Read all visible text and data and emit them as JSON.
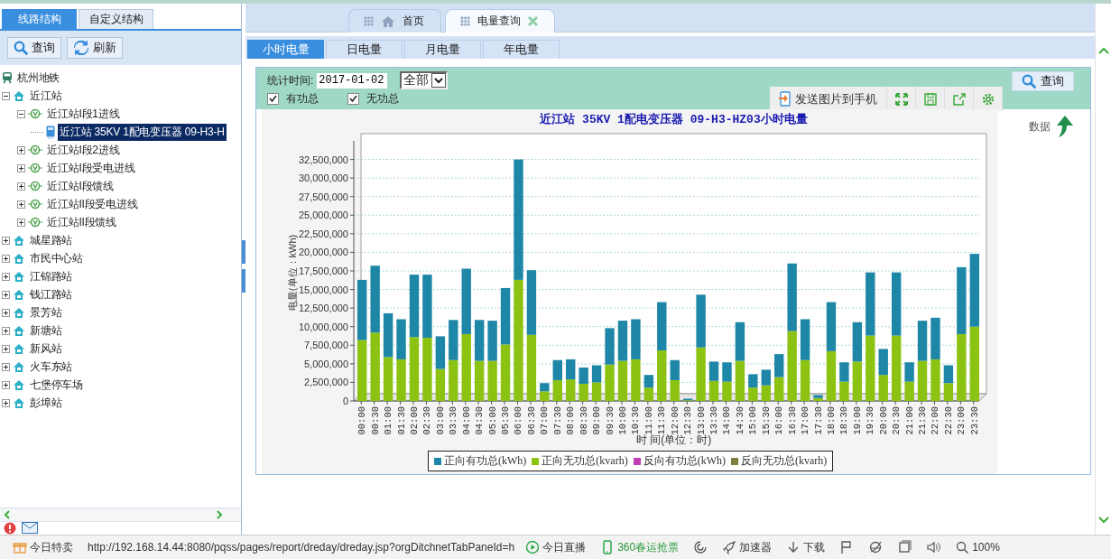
{
  "sidebar": {
    "tabs": [
      {
        "label": "线路结构",
        "selected": true
      },
      {
        "label": "自定义结构",
        "selected": false
      }
    ],
    "buttons": [
      {
        "label": "查询",
        "kind": "search"
      },
      {
        "label": "刷新",
        "kind": "refresh"
      }
    ],
    "tree": [
      {
        "label": "杭州地铁",
        "kind": "network",
        "selected": false,
        "children": [
          {
            "label": "近江站",
            "kind": "station",
            "expanded": true,
            "selected": false,
            "children": [
              {
                "label": "近江站I段1进线",
                "kind": "line",
                "expanded": true,
                "selected": false,
                "children": [
                  {
                    "label": "近江站 35KV 1配电变压器 09-H3-H",
                    "kind": "device",
                    "selected": true
                  }
                ]
              },
              {
                "label": "近江站I段2进线",
                "kind": "line",
                "expanded": false,
                "selected": false
              },
              {
                "label": "近江站I段受电进线",
                "kind": "line",
                "expanded": false,
                "selected": false
              },
              {
                "label": "近江站I段馈线",
                "kind": "line",
                "expanded": false,
                "selected": false
              },
              {
                "label": "近江站II段受电进线",
                "kind": "line",
                "expanded": false,
                "selected": false
              },
              {
                "label": "近江站II段馈线",
                "kind": "line",
                "expanded": false,
                "selected": false
              }
            ]
          },
          {
            "label": "城星路站",
            "kind": "station",
            "expanded": false,
            "selected": false
          },
          {
            "label": "市民中心站",
            "kind": "station",
            "expanded": false,
            "selected": false
          },
          {
            "label": "江锦路站",
            "kind": "station",
            "expanded": false,
            "selected": false
          },
          {
            "label": "钱江路站",
            "kind": "station",
            "expanded": false,
            "selected": false
          },
          {
            "label": "景芳站",
            "kind": "station",
            "expanded": false,
            "selected": false
          },
          {
            "label": "新塘站",
            "kind": "station",
            "expanded": false,
            "selected": false
          },
          {
            "label": "新风站",
            "kind": "station",
            "expanded": false,
            "selected": false
          },
          {
            "label": "火车东站",
            "kind": "station",
            "expanded": false,
            "selected": false
          },
          {
            "label": "七堡停车场",
            "kind": "station",
            "expanded": false,
            "selected": false
          },
          {
            "label": "彭埠站",
            "kind": "station",
            "expanded": false,
            "selected": false
          }
        ]
      }
    ]
  },
  "main": {
    "tabs": [
      {
        "label": "首页",
        "kind": "home",
        "selected": false
      },
      {
        "label": "电量查询",
        "kind": "page",
        "selected": true
      }
    ],
    "subtabs": [
      {
        "label": "小时电量",
        "selected": true
      },
      {
        "label": "日电量",
        "selected": false
      },
      {
        "label": "月电量",
        "selected": false
      },
      {
        "label": "年电量",
        "selected": false
      }
    ],
    "filter": {
      "label": "统计时间:",
      "date": "2017-01-02",
      "scope": "全部",
      "checkboxes": [
        {
          "label": "有功总",
          "checked": true
        },
        {
          "label": "无功总",
          "checked": true
        }
      ]
    },
    "search_button": "查询",
    "chart_toolbar": {
      "send_label": "发送图片到手机",
      "tools": [
        {
          "kind": "fullscreen"
        },
        {
          "kind": "save"
        },
        {
          "kind": "export"
        },
        {
          "kind": "settings"
        }
      ]
    },
    "data_toggle": "数据",
    "chart_data": {
      "type": "bar",
      "stacked": true,
      "grid": true,
      "title": "近江站 35KV 1配电变压器 09-H3-HZ03小时电量",
      "xlabel": "时 间(单位：时)",
      "ylabel": "电量(单位：kWh)",
      "categories": [
        "00:00",
        "00:30",
        "01:00",
        "01:30",
        "02:00",
        "02:30",
        "03:00",
        "03:30",
        "04:00",
        "04:30",
        "05:00",
        "05:30",
        "06:00",
        "06:30",
        "07:00",
        "07:30",
        "08:00",
        "08:30",
        "09:00",
        "09:30",
        "10:00",
        "10:30",
        "11:00",
        "11:30",
        "12:00",
        "12:30",
        "13:00",
        "13:30",
        "14:00",
        "14:30",
        "15:00",
        "15:30",
        "16:00",
        "16:30",
        "17:00",
        "17:30",
        "18:00",
        "18:30",
        "19:00",
        "19:30",
        "20:00",
        "20:30",
        "21:00",
        "21:30",
        "22:00",
        "22:30",
        "23:00",
        "23:30"
      ],
      "ylim": [
        0,
        35000000
      ],
      "yticks": [
        {
          "value": 0,
          "label": "0"
        },
        {
          "value": 2500000,
          "label": "2,500,000"
        },
        {
          "value": 5000000,
          "label": "5,000,000"
        },
        {
          "value": 7500000,
          "label": "7,500,000"
        },
        {
          "value": 10000000,
          "label": "10,000,000"
        },
        {
          "value": 12500000,
          "label": "12,500,000"
        },
        {
          "value": 15000000,
          "label": "15,000,000"
        },
        {
          "value": 17500000,
          "label": "17,500,000"
        },
        {
          "value": 20000000,
          "label": "20,000,000"
        },
        {
          "value": 22500000,
          "label": "22,500,000"
        },
        {
          "value": 25000000,
          "label": "25,000,000"
        },
        {
          "value": 27500000,
          "label": "27,500,000"
        },
        {
          "value": 30000000,
          "label": "30,000,000"
        },
        {
          "value": 32500000,
          "label": "32,500,000"
        }
      ],
      "series": [
        {
          "name": "正向有功总(kWh)",
          "color": "#1e86a6",
          "values": [
            8100000,
            9000000,
            5900000,
            5400000,
            8400000,
            8500000,
            4400000,
            5400000,
            8800000,
            5500000,
            5400000,
            7600000,
            16200000,
            8700000,
            1100000,
            2700000,
            2700000,
            2200000,
            2300000,
            4900000,
            5400000,
            5400000,
            1700000,
            6500000,
            2700000,
            200000,
            7100000,
            2600000,
            2600000,
            5200000,
            1800000,
            2100000,
            3100000,
            9100000,
            5500000,
            400000,
            6600000,
            2600000,
            5300000,
            8500000,
            3500000,
            8500000,
            2600000,
            5400000,
            5600000,
            2400000,
            9000000,
            9800000
          ]
        },
        {
          "name": "正向无功总(kvarh)",
          "color": "#8cc312",
          "values": [
            8200000,
            9200000,
            5900000,
            5600000,
            8600000,
            8500000,
            4300000,
            5500000,
            9000000,
            5400000,
            5400000,
            7600000,
            16300000,
            8900000,
            1300000,
            2800000,
            2900000,
            2300000,
            2500000,
            4900000,
            5400000,
            5600000,
            1800000,
            6800000,
            2800000,
            100000,
            7200000,
            2700000,
            2600000,
            5400000,
            1800000,
            2100000,
            3200000,
            9400000,
            5500000,
            400000,
            6700000,
            2600000,
            5300000,
            8800000,
            3500000,
            8800000,
            2600000,
            5400000,
            5600000,
            2400000,
            9000000,
            10000000
          ]
        },
        {
          "name": "反向有功总(kWh)",
          "color": "#c040b4",
          "values": [
            0,
            0,
            0,
            0,
            0,
            0,
            0,
            0,
            0,
            0,
            0,
            0,
            0,
            0,
            0,
            0,
            0,
            0,
            0,
            0,
            0,
            0,
            0,
            0,
            0,
            0,
            0,
            0,
            0,
            0,
            0,
            0,
            0,
            0,
            0,
            0,
            0,
            0,
            0,
            0,
            0,
            0,
            0,
            0,
            0,
            0,
            0,
            0
          ]
        },
        {
          "name": "反向无功总(kvarh)",
          "color": "#7f7f3f",
          "values": [
            0,
            0,
            0,
            0,
            0,
            0,
            0,
            0,
            0,
            0,
            0,
            0,
            0,
            0,
            0,
            0,
            0,
            0,
            0,
            0,
            0,
            0,
            0,
            0,
            0,
            0,
            0,
            0,
            0,
            0,
            0,
            0,
            0,
            0,
            0,
            0,
            0,
            0,
            0,
            0,
            0,
            0,
            0,
            0,
            0,
            0,
            0,
            0
          ]
        }
      ]
    }
  },
  "status_bar": {
    "items": [
      {
        "kind": "gift",
        "label": "今日特卖"
      },
      {
        "kind": "url",
        "label": "http://192.168.14.44:8080/pqss/pages/report/dreday/dreday.jsp?orgDitchnetTabPaneId=h"
      },
      {
        "kind": "play",
        "label": "今日直播"
      },
      {
        "kind": "phone",
        "label": "360春运抢票"
      },
      {
        "kind": "swirl"
      },
      {
        "kind": "rocket",
        "label": "加速器"
      },
      {
        "kind": "download",
        "label": "下载"
      },
      {
        "kind": "flag"
      },
      {
        "kind": "browser"
      },
      {
        "kind": "window"
      },
      {
        "kind": "speaker"
      },
      {
        "kind": "zoom",
        "label": "100%"
      }
    ]
  }
}
